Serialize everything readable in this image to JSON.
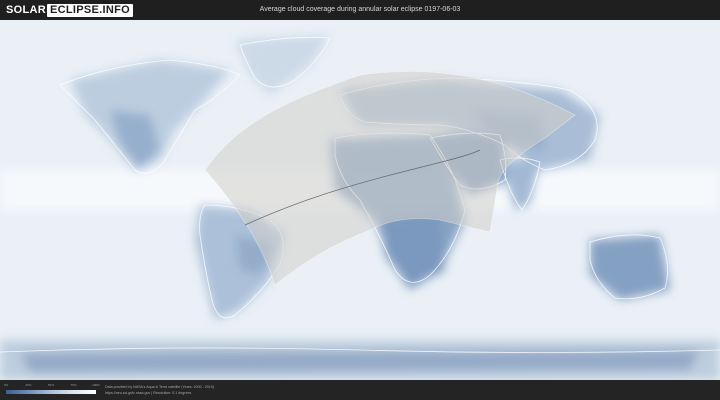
{
  "logo": {
    "part1": "SOLAR",
    "part2": "ECLIPSE.INFO"
  },
  "title": "Average cloud coverage during annular solar eclipse 0197-06-03",
  "legend": {
    "ticks": [
      "0%",
      "25%",
      "50%",
      "75%",
      "100%"
    ],
    "gradient": [
      "#3e5f90",
      "#6f8fb8",
      "#a9c0da",
      "#dbe6f1",
      "#ffffff"
    ]
  },
  "credits": {
    "line1": "Data provided by NASA's Aqua & Terra satellite (Years: 2000 - 2019)",
    "line2": "https://neo.sci.gsfc.nasa.gov | Resolution: 0.1 degrees"
  },
  "colors": {
    "clear_sky": "#6f8fb8",
    "cloudy": "#f4f7fb",
    "eclipse_zone": "#d2d0ca",
    "eclipse_path": "#555555"
  }
}
